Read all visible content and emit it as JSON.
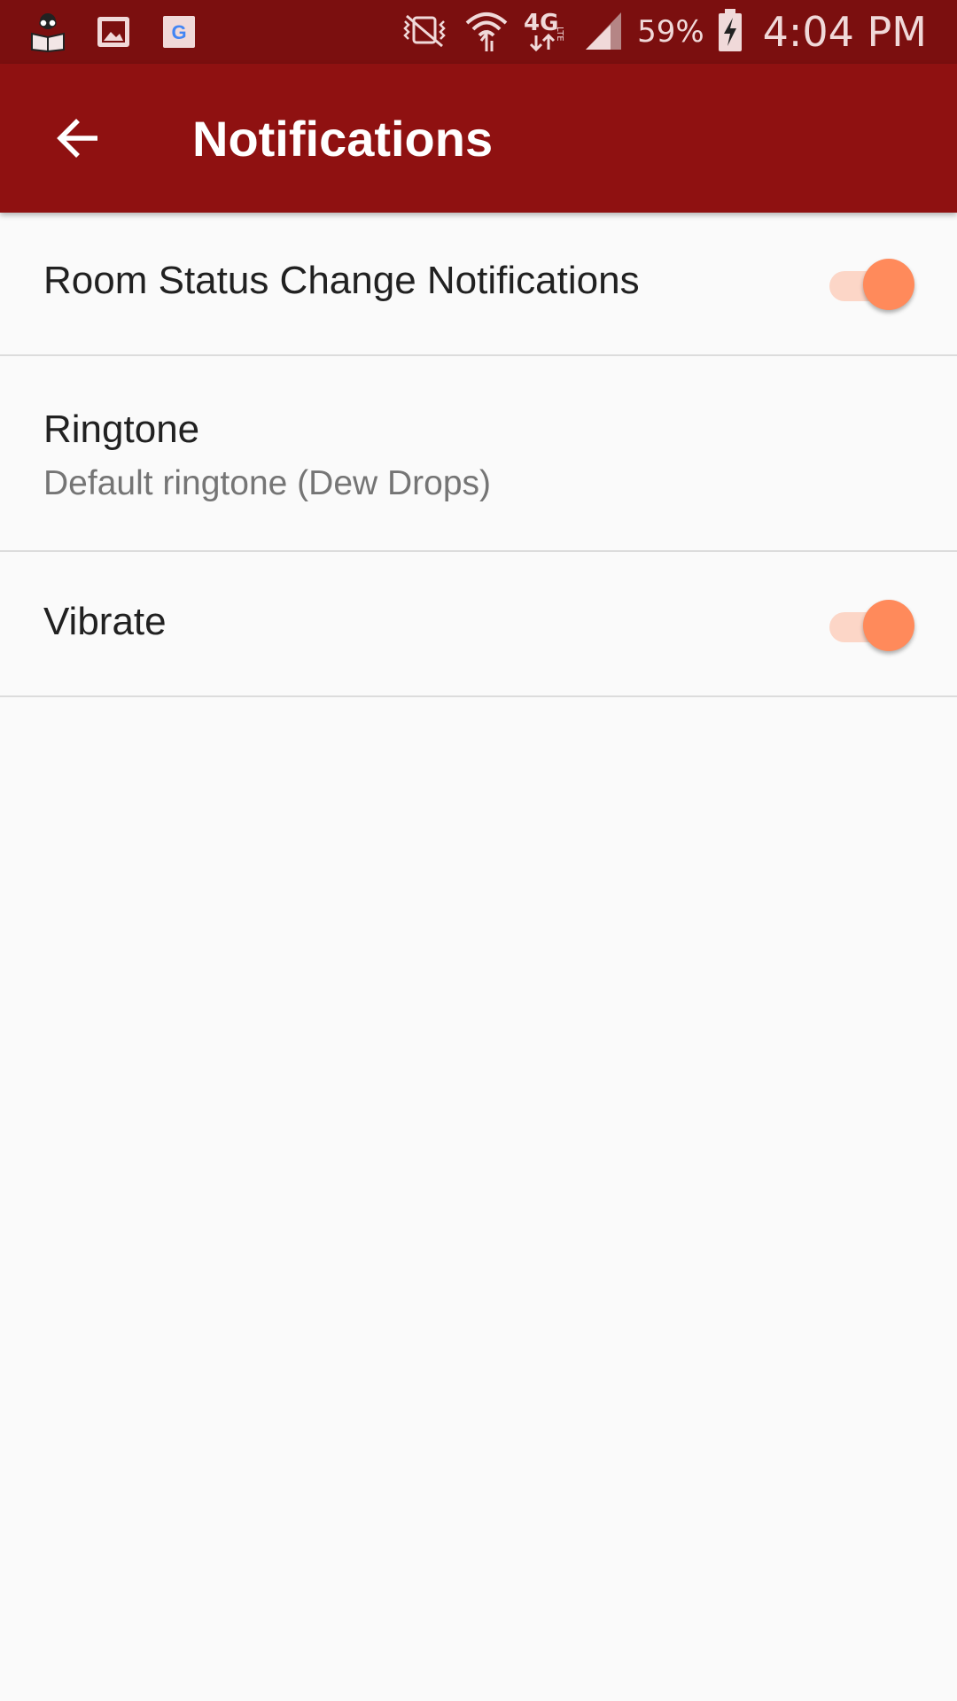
{
  "status_bar": {
    "battery_percent": "59%",
    "time": "4:04 PM",
    "icons": [
      "reader-app-icon",
      "gallery-icon",
      "google-icon",
      "vibrate-mute-icon",
      "wifi-icon",
      "4g-lte-icon",
      "signal-icon",
      "battery-charging-icon"
    ]
  },
  "app_bar": {
    "title": "Notifications",
    "back_icon": "arrow-back-icon"
  },
  "settings": [
    {
      "title": "Room Status Change Notifications",
      "toggle_on": true
    },
    {
      "title": "Ringtone",
      "summary": "Default ringtone (Dew Drops)"
    },
    {
      "title": "Vibrate",
      "toggle_on": true
    }
  ],
  "colors": {
    "status_bar": "#7b0f0f",
    "app_bar": "#8f1111",
    "switch_thumb": "#ff8a5b",
    "switch_track": "#fcd6c7",
    "background": "#fafafa"
  }
}
